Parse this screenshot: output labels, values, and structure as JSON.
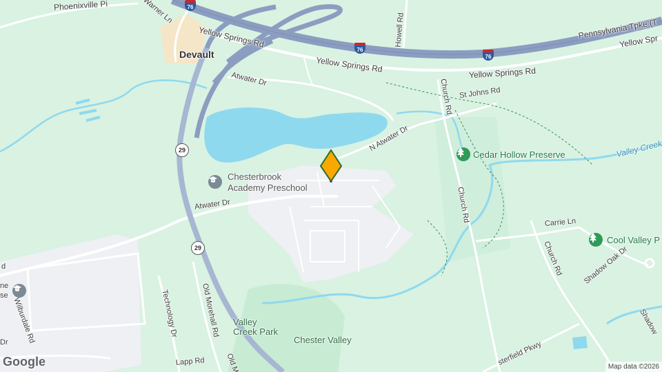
{
  "map": {
    "labels": {
      "phoenixville": "Phoenixville Pi",
      "warner": "Warner Ln",
      "devault": "Devault",
      "yellow_springs_1": "Yellow Springs Rd",
      "yellow_springs_2": "Yellow Springs Rd",
      "yellow_springs_3": "Yellow Springs Rd",
      "yellow_springs_4": "Yellow Spr",
      "howell": "Howell Rd",
      "turnpike": "Pennsylvania Tpke (T",
      "atwater_top": "Atwater Dr",
      "st_johns": "St Johns Rd",
      "church_1": "Church Rd",
      "church_2": "Church Rd",
      "church_3": "Church Rd",
      "n_atwater": "N Atwater Dr",
      "cedar_hollow": "Cedar Hollow Preserve",
      "valley_creek_water": "Valley Creek",
      "chesterbrook_1": "Chesterbrook",
      "chesterbrook_2": "Academy Preschool",
      "atwater_bottom": "Atwater Dr",
      "carrie": "Carrie Ln",
      "cool_valley": "Cool Valley P",
      "shadow_oak": "Shadow Oak Dr",
      "shadow": "Shadow",
      "technology": "Technology Dr",
      "old_morehall_1": "Old Morehall Rd",
      "old_morehall_2": "Old M",
      "wilburdale": "Wilburdale Rd",
      "valley_creek_park_1": "Valley",
      "valley_creek_park_2": "Creek Park",
      "chester_valley": "Chester Valley",
      "lapp": "Lapp Rd",
      "chesterfield": "sterfield Pkwy",
      "left_d": "d",
      "left_ne": "ne",
      "left_se": "se",
      "left_dr": "Dr"
    },
    "route_29": "29",
    "interstate_76": "76",
    "pin_color": "#f9a800",
    "colors": {
      "background": "#d9f2e2",
      "water": "#8fd9ee",
      "highway": "#8b9dc0",
      "road": "#ffffff",
      "developed": "#eef0f3",
      "town": "#f5e6c8"
    }
  },
  "google_logo": "Google",
  "attribution": "Map data ©2026"
}
